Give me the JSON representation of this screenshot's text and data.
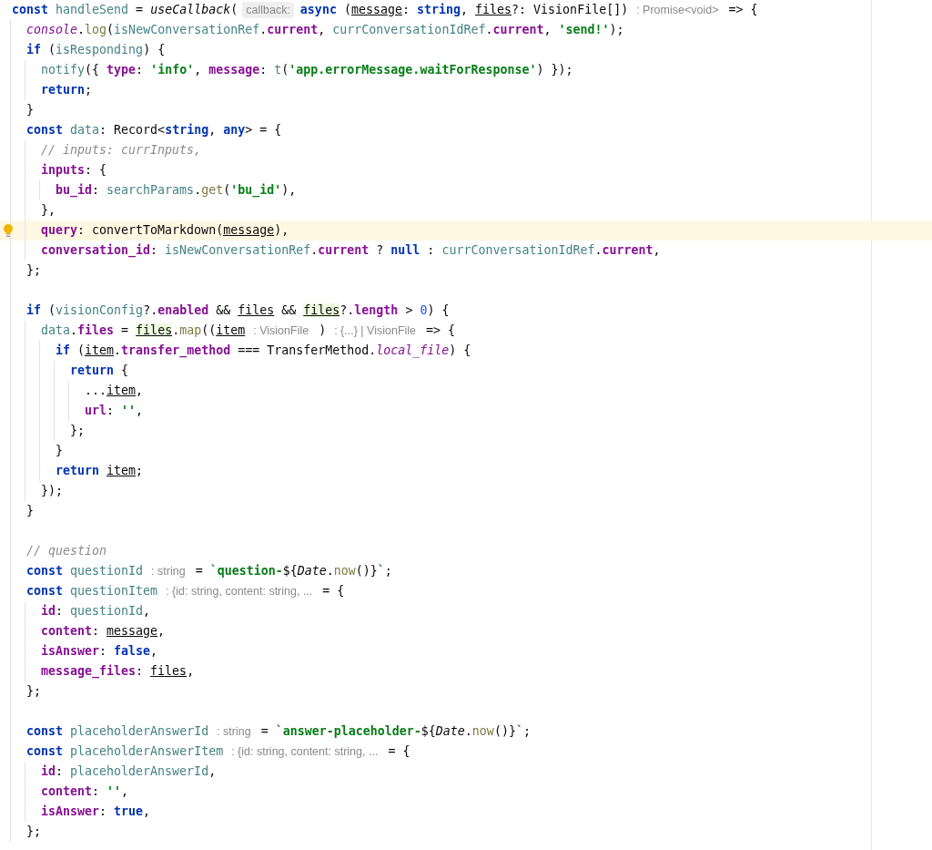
{
  "editor": {
    "lines": [
      {
        "current": false,
        "parts": [
          {
            "kind": "kw",
            "t": "const "
          },
          {
            "kind": "var",
            "t": "handleSend"
          },
          {
            "kind": "txt",
            "t": " = "
          },
          {
            "kind": "it",
            "t": "useCallback"
          },
          {
            "kind": "txt",
            "t": "("
          },
          {
            "kind": "label-hint",
            "t": "callback:"
          },
          {
            "kind": "kw",
            "t": "async "
          },
          {
            "kind": "txt",
            "t": "("
          },
          {
            "kind": "param",
            "t": "message"
          },
          {
            "kind": "txt",
            "t": ": "
          },
          {
            "kind": "kw",
            "t": "string"
          },
          {
            "kind": "txt",
            "t": ", "
          },
          {
            "kind": "param",
            "t": "files"
          },
          {
            "kind": "txt",
            "t": "?: VisionFile[])"
          },
          {
            "kind": "type-hint",
            "t": ": Promise<void>"
          },
          {
            "kind": "txt",
            "t": "=> {"
          }
        ]
      },
      {
        "current": false,
        "parts": [
          {
            "kind": "static",
            "t": "  console"
          },
          {
            "kind": "txt",
            "t": "."
          },
          {
            "kind": "fn",
            "t": "log"
          },
          {
            "kind": "txt",
            "t": "("
          },
          {
            "kind": "var",
            "t": "isNewConversationRef"
          },
          {
            "kind": "txt",
            "t": "."
          },
          {
            "kind": "prop",
            "t": "current"
          },
          {
            "kind": "txt",
            "t": ", "
          },
          {
            "kind": "var",
            "t": "currConversationIdRef"
          },
          {
            "kind": "txt",
            "t": "."
          },
          {
            "kind": "prop",
            "t": "current"
          },
          {
            "kind": "txt",
            "t": ", "
          },
          {
            "kind": "str",
            "t": "'send!'"
          },
          {
            "kind": "txt",
            "t": ");"
          }
        ]
      },
      {
        "current": false,
        "parts": [
          {
            "kind": "kw",
            "t": "  if "
          },
          {
            "kind": "txt",
            "t": "("
          },
          {
            "kind": "var",
            "t": "isResponding"
          },
          {
            "kind": "txt",
            "t": ") {"
          }
        ]
      },
      {
        "current": false,
        "parts": [
          {
            "kind": "var",
            "t": "    notify"
          },
          {
            "kind": "txt",
            "t": "({ "
          },
          {
            "kind": "prop",
            "t": "type"
          },
          {
            "kind": "txt",
            "t": ": "
          },
          {
            "kind": "str",
            "t": "'info'"
          },
          {
            "kind": "txt",
            "t": ", "
          },
          {
            "kind": "prop",
            "t": "message"
          },
          {
            "kind": "txt",
            "t": ": "
          },
          {
            "kind": "var",
            "t": "t"
          },
          {
            "kind": "txt",
            "t": "("
          },
          {
            "kind": "str",
            "t": "'app.errorMessage.waitForResponse'"
          },
          {
            "kind": "txt",
            "t": ") });"
          }
        ]
      },
      {
        "current": false,
        "parts": [
          {
            "kind": "kw",
            "t": "    return"
          },
          {
            "kind": "txt",
            "t": ";"
          }
        ]
      },
      {
        "current": false,
        "parts": [
          {
            "kind": "txt",
            "t": "  }"
          }
        ]
      },
      {
        "current": false,
        "parts": [
          {
            "kind": "kw",
            "t": "  const "
          },
          {
            "kind": "var",
            "t": "data"
          },
          {
            "kind": "txt",
            "t": ": Record<"
          },
          {
            "kind": "kw",
            "t": "string"
          },
          {
            "kind": "txt",
            "t": ", "
          },
          {
            "kind": "kw",
            "t": "any"
          },
          {
            "kind": "txt",
            "t": "> = {"
          }
        ]
      },
      {
        "current": false,
        "parts": [
          {
            "kind": "cm",
            "t": "    // inputs: currInputs,"
          }
        ]
      },
      {
        "current": false,
        "parts": [
          {
            "kind": "prop",
            "t": "    inputs"
          },
          {
            "kind": "txt",
            "t": ": {"
          }
        ]
      },
      {
        "current": false,
        "parts": [
          {
            "kind": "prop",
            "t": "      bu_id"
          },
          {
            "kind": "txt",
            "t": ": "
          },
          {
            "kind": "var",
            "t": "searchParams"
          },
          {
            "kind": "txt",
            "t": "."
          },
          {
            "kind": "fn",
            "t": "get"
          },
          {
            "kind": "txt",
            "t": "("
          },
          {
            "kind": "str",
            "t": "'bu_id'"
          },
          {
            "kind": "txt",
            "t": "),"
          }
        ]
      },
      {
        "current": false,
        "parts": [
          {
            "kind": "txt",
            "t": "    },"
          }
        ]
      },
      {
        "current": true,
        "parts": [
          {
            "kind": "prop",
            "t": "    query"
          },
          {
            "kind": "txt",
            "t": ": convertToMarkdown("
          },
          {
            "kind": "param",
            "t": "message"
          },
          {
            "kind": "txt",
            "t": "),"
          }
        ]
      },
      {
        "current": false,
        "parts": [
          {
            "kind": "prop",
            "t": "    conversation_id"
          },
          {
            "kind": "txt",
            "t": ": "
          },
          {
            "kind": "var",
            "t": "isNewConversationRef"
          },
          {
            "kind": "txt",
            "t": "."
          },
          {
            "kind": "prop",
            "t": "current"
          },
          {
            "kind": "txt",
            "t": " ? "
          },
          {
            "kind": "kw",
            "t": "null"
          },
          {
            "kind": "txt",
            "t": " : "
          },
          {
            "kind": "var",
            "t": "currConversationIdRef"
          },
          {
            "kind": "txt",
            "t": "."
          },
          {
            "kind": "prop",
            "t": "current"
          },
          {
            "kind": "txt",
            "t": ","
          }
        ]
      },
      {
        "current": false,
        "parts": [
          {
            "kind": "txt",
            "t": "  };"
          }
        ]
      },
      {
        "kind": "blank"
      },
      {
        "current": false,
        "parts": [
          {
            "kind": "kw",
            "t": "  if "
          },
          {
            "kind": "txt",
            "t": "("
          },
          {
            "kind": "var",
            "t": "visionConfig"
          },
          {
            "kind": "txt",
            "t": "?."
          },
          {
            "kind": "prop",
            "t": "enabled"
          },
          {
            "kind": "txt",
            "t": " && "
          },
          {
            "kind": "param",
            "t": "files"
          },
          {
            "kind": "txt",
            "t": " && "
          },
          {
            "kind": "param-hl",
            "t": "files"
          },
          {
            "kind": "txt",
            "t": "?."
          },
          {
            "kind": "prop",
            "t": "length"
          },
          {
            "kind": "txt",
            "t": " > "
          },
          {
            "kind": "num",
            "t": "0"
          },
          {
            "kind": "txt",
            "t": ") {"
          }
        ]
      },
      {
        "current": false,
        "parts": [
          {
            "kind": "var",
            "t": "    data"
          },
          {
            "kind": "txt",
            "t": "."
          },
          {
            "kind": "prop",
            "t": "files"
          },
          {
            "kind": "txt",
            "t": " = "
          },
          {
            "kind": "param-hl",
            "t": "files"
          },
          {
            "kind": "txt",
            "t": "."
          },
          {
            "kind": "fn",
            "t": "map"
          },
          {
            "kind": "txt",
            "t": "(("
          },
          {
            "kind": "param",
            "t": "item"
          },
          {
            "kind": "type-hint",
            "t": ": VisionFile"
          },
          {
            "kind": "txt",
            "t": ")"
          },
          {
            "kind": "type-hint",
            "t": ": {...} | VisionFile"
          },
          {
            "kind": "txt",
            "t": "=> {"
          }
        ]
      },
      {
        "current": false,
        "parts": [
          {
            "kind": "kw",
            "t": "      if "
          },
          {
            "kind": "txt",
            "t": "("
          },
          {
            "kind": "param",
            "t": "item"
          },
          {
            "kind": "txt",
            "t": "."
          },
          {
            "kind": "prop",
            "t": "transfer_method"
          },
          {
            "kind": "txt",
            "t": " === TransferMethod."
          },
          {
            "kind": "static",
            "t": "local_file"
          },
          {
            "kind": "txt",
            "t": ") {"
          }
        ]
      },
      {
        "current": false,
        "parts": [
          {
            "kind": "kw",
            "t": "        return "
          },
          {
            "kind": "txt",
            "t": "{"
          }
        ]
      },
      {
        "current": false,
        "parts": [
          {
            "kind": "txt",
            "t": "          ..."
          },
          {
            "kind": "param",
            "t": "item"
          },
          {
            "kind": "txt",
            "t": ","
          }
        ]
      },
      {
        "current": false,
        "parts": [
          {
            "kind": "prop",
            "t": "          url"
          },
          {
            "kind": "txt",
            "t": ": "
          },
          {
            "kind": "str",
            "t": "''"
          },
          {
            "kind": "txt",
            "t": ","
          }
        ]
      },
      {
        "current": false,
        "parts": [
          {
            "kind": "txt",
            "t": "        };"
          }
        ]
      },
      {
        "current": false,
        "parts": [
          {
            "kind": "txt",
            "t": "      }"
          }
        ]
      },
      {
        "current": false,
        "parts": [
          {
            "kind": "kw",
            "t": "      return "
          },
          {
            "kind": "param",
            "t": "item"
          },
          {
            "kind": "txt",
            "t": ";"
          }
        ]
      },
      {
        "current": false,
        "parts": [
          {
            "kind": "txt",
            "t": "    });"
          }
        ]
      },
      {
        "current": false,
        "parts": [
          {
            "kind": "txt",
            "t": "  }"
          }
        ]
      },
      {
        "kind": "blank"
      },
      {
        "current": false,
        "parts": [
          {
            "kind": "cm",
            "t": "  // question"
          }
        ]
      },
      {
        "current": false,
        "parts": [
          {
            "kind": "kw",
            "t": "  const "
          },
          {
            "kind": "var",
            "t": "questionId"
          },
          {
            "kind": "type-hint",
            "t": ": string"
          },
          {
            "kind": "txt",
            "t": "= "
          },
          {
            "kind": "str",
            "t": "`question-"
          },
          {
            "kind": "txt",
            "t": "${"
          },
          {
            "kind": "it",
            "t": "Date"
          },
          {
            "kind": "txt",
            "t": "."
          },
          {
            "kind": "fn",
            "t": "now"
          },
          {
            "kind": "txt",
            "t": "()}"
          },
          {
            "kind": "str",
            "t": "`"
          },
          {
            "kind": "txt",
            "t": ";"
          }
        ]
      },
      {
        "current": false,
        "parts": [
          {
            "kind": "kw",
            "t": "  const "
          },
          {
            "kind": "var",
            "t": "questionItem"
          },
          {
            "kind": "type-hint",
            "t": ": {id: string, content: string, ..."
          },
          {
            "kind": "txt",
            "t": "= {"
          }
        ]
      },
      {
        "current": false,
        "parts": [
          {
            "kind": "prop",
            "t": "    id"
          },
          {
            "kind": "txt",
            "t": ": "
          },
          {
            "kind": "var",
            "t": "questionId"
          },
          {
            "kind": "txt",
            "t": ","
          }
        ]
      },
      {
        "current": false,
        "parts": [
          {
            "kind": "prop",
            "t": "    content"
          },
          {
            "kind": "txt",
            "t": ": "
          },
          {
            "kind": "param",
            "t": "message"
          },
          {
            "kind": "txt",
            "t": ","
          }
        ]
      },
      {
        "current": false,
        "parts": [
          {
            "kind": "prop",
            "t": "    isAnswer"
          },
          {
            "kind": "txt",
            "t": ": "
          },
          {
            "kind": "kw",
            "t": "false"
          },
          {
            "kind": "txt",
            "t": ","
          }
        ]
      },
      {
        "current": false,
        "parts": [
          {
            "kind": "prop",
            "t": "    message_files"
          },
          {
            "kind": "txt",
            "t": ": "
          },
          {
            "kind": "param",
            "t": "files"
          },
          {
            "kind": "txt",
            "t": ","
          }
        ]
      },
      {
        "current": false,
        "parts": [
          {
            "kind": "txt",
            "t": "  };"
          }
        ]
      },
      {
        "kind": "blank"
      },
      {
        "current": false,
        "parts": [
          {
            "kind": "kw",
            "t": "  const "
          },
          {
            "kind": "var",
            "t": "placeholderAnswerId"
          },
          {
            "kind": "type-hint",
            "t": ": string"
          },
          {
            "kind": "txt",
            "t": "= "
          },
          {
            "kind": "str",
            "t": "`answer-placeholder-"
          },
          {
            "kind": "txt",
            "t": "${"
          },
          {
            "kind": "it",
            "t": "Date"
          },
          {
            "kind": "txt",
            "t": "."
          },
          {
            "kind": "fn",
            "t": "now"
          },
          {
            "kind": "txt",
            "t": "()}"
          },
          {
            "kind": "str",
            "t": "`"
          },
          {
            "kind": "txt",
            "t": ";"
          }
        ]
      },
      {
        "current": false,
        "parts": [
          {
            "kind": "kw",
            "t": "  const "
          },
          {
            "kind": "var",
            "t": "placeholderAnswerItem"
          },
          {
            "kind": "type-hint",
            "t": ": {id: string, content: string, ..."
          },
          {
            "kind": "txt",
            "t": "= {"
          }
        ]
      },
      {
        "current": false,
        "parts": [
          {
            "kind": "prop",
            "t": "    id"
          },
          {
            "kind": "txt",
            "t": ": "
          },
          {
            "kind": "var",
            "t": "placeholderAnswerId"
          },
          {
            "kind": "txt",
            "t": ","
          }
        ]
      },
      {
        "current": false,
        "parts": [
          {
            "kind": "prop",
            "t": "    content"
          },
          {
            "kind": "txt",
            "t": ": "
          },
          {
            "kind": "str",
            "t": "''"
          },
          {
            "kind": "txt",
            "t": ","
          }
        ]
      },
      {
        "current": false,
        "parts": [
          {
            "kind": "prop",
            "t": "    isAnswer"
          },
          {
            "kind": "txt",
            "t": ": "
          },
          {
            "kind": "kw",
            "t": "true"
          },
          {
            "kind": "txt",
            "t": ","
          }
        ]
      },
      {
        "current": false,
        "parts": [
          {
            "kind": "txt",
            "t": "  };"
          }
        ]
      }
    ]
  }
}
